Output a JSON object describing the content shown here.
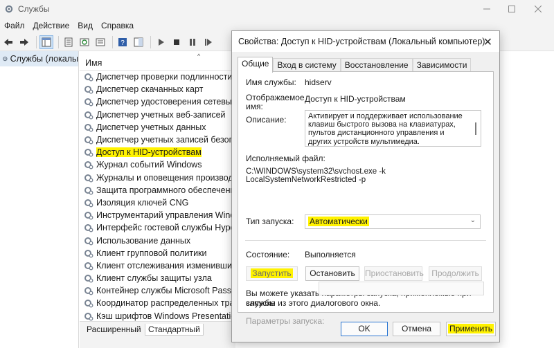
{
  "window": {
    "title": "Службы",
    "menu": [
      "Файл",
      "Действие",
      "Вид",
      "Справка"
    ]
  },
  "toolbar": {
    "icons": [
      "back-arrow-icon",
      "forward-arrow-icon",
      "console-tree-icon",
      "properties-icon",
      "export-list-icon",
      "help-icon",
      "show-hide-icon",
      "play-icon",
      "stop-icon",
      "pause-icon",
      "restart-icon"
    ]
  },
  "tree": {
    "root_label": "Службы (локалы"
  },
  "list": {
    "header": "Имя",
    "rows": [
      "Диспетчер проверки подлинности Xb",
      "Диспетчер скачанных карт",
      "Диспетчер удостоверения сетевых уч",
      "Диспетчер учетных веб-записей",
      "Диспетчер учетных данных",
      "Диспетчер учетных записей безопас",
      "Доступ к HID-устройствам",
      "Журнал событий Windows",
      "Журналы и оповещения производит",
      "Защита программного обеспечения",
      "Изоляция ключей CNG",
      "Инструментарий управления Window",
      "Интерфейс гостевой службы Hyper-V",
      "Использование данных",
      "Клиент групповой политики",
      "Клиент отслеживания изменившихся",
      "Клиент службы защиты узла",
      "Контейнер службы Microsoft Passport",
      "Координатор распределенных транз",
      "Кэш шрифтов Windows Presentation I"
    ],
    "highlighted_row": "Доступ к HID-устройствам",
    "bottom_tabs": [
      "Расширенный",
      "Стандартный"
    ]
  },
  "dialog": {
    "title": "Свойства: Доступ к HID-устройствам (Локальный компьютер)",
    "tabs": [
      "Общие",
      "Вход в систему",
      "Восстановление",
      "Зависимости"
    ],
    "service_name_label": "Имя службы:",
    "service_name": "hidserv",
    "display_name_label": "Отображаемое имя:",
    "display_name_label_1": "Отображаемое",
    "display_name_label_2": "имя:",
    "display_name": "Доступ к HID-устройствам",
    "description_label": "Описание:",
    "description": "Активирует и поддерживает использование клавиш быстрого вызова на клавиатурах, пультов дистанционного управления и других устройств мультимедиа. Отключение этой",
    "executable_label": "Исполняемый файл:",
    "executable_path": "C:\\WINDOWS\\system32\\svchost.exe -k LocalSystemNetworkRestricted -p",
    "startup_type_label": "Тип запуска:",
    "startup_type": "Автоматически",
    "status_label": "Состояние:",
    "status_value": "Выполняется",
    "btn_start": "Запустить",
    "btn_stop": "Остановить",
    "btn_pause": "Приостановить",
    "btn_resume": "Продолжить",
    "hint": "Вы можете указать параметры запуска, применяемые при запуске службы из этого диалогового окна.",
    "hint_1": "Вы можете указать параметры запуска, применяемые при запуске",
    "hint_2": "службы из этого диалогового окна.",
    "params_label": "Параметры запуска:",
    "btn_ok": "OK",
    "btn_cancel": "Отмена",
    "btn_apply": "Применить"
  },
  "colors": {
    "highlight": "#fff200",
    "accent": "#2a76d2"
  }
}
